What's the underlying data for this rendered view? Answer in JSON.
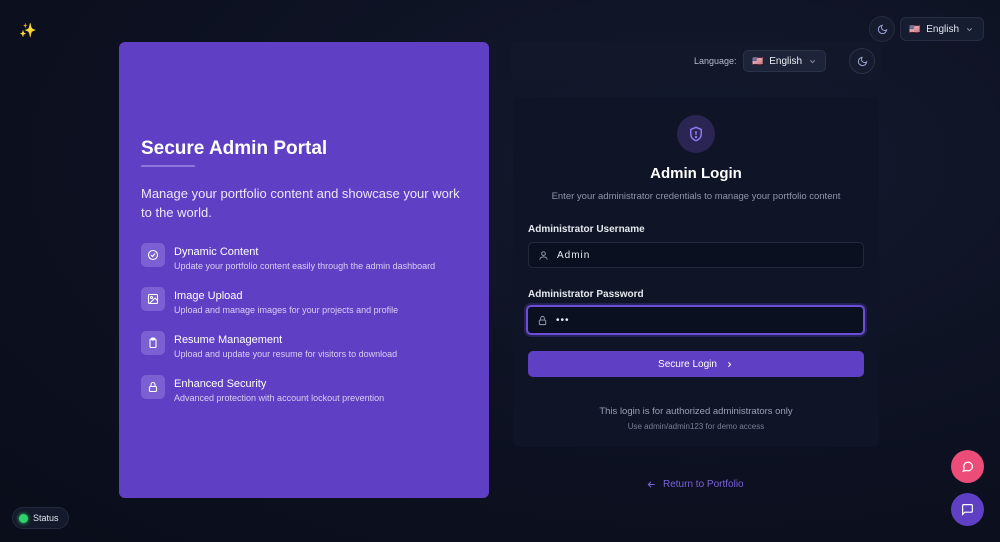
{
  "header": {
    "sparkle_icon": "sparkle-icon",
    "theme_icon": "moon-icon",
    "language_value": "English",
    "language_flag": "🇺🇸"
  },
  "promo": {
    "title": "Secure Admin Portal",
    "subtitle": "Manage your portfolio content and showcase your work to the world.",
    "features": [
      {
        "icon": "check-circle-icon",
        "title": "Dynamic Content",
        "desc": "Update your portfolio content easily through the admin dashboard"
      },
      {
        "icon": "image-icon",
        "title": "Image Upload",
        "desc": "Upload and manage images for your projects and profile"
      },
      {
        "icon": "clipboard-icon",
        "title": "Resume Management",
        "desc": "Upload and update your resume for visitors to download"
      },
      {
        "icon": "lock-icon",
        "title": "Enhanced Security",
        "desc": "Advanced protection with account lockout prevention"
      }
    ]
  },
  "langbar": {
    "label": "Language:",
    "value": "English",
    "flag": "🇺🇸"
  },
  "login": {
    "title": "Admin Login",
    "subtitle": "Enter your administrator credentials to manage your portfolio content",
    "username_label": "Administrator Username",
    "username_value": "Admin",
    "password_label": "Administrator Password",
    "password_value": "•••",
    "button_label": "Secure Login",
    "note": "This login is for authorized administrators only",
    "demo_note": "Use admin/admin123 for demo access"
  },
  "return_link": "Return to Portfolio",
  "status_label": "Status",
  "colors": {
    "accent": "#5f3fc3",
    "chat_pink": "#ec4d78",
    "status_green": "#2fd36b"
  }
}
